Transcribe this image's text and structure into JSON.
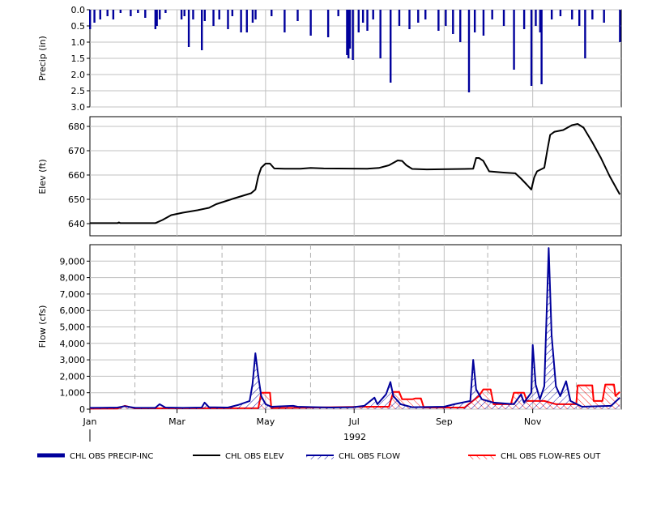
{
  "colors": {
    "precip": "#00009c",
    "elev": "#000000",
    "flow": "#00009c",
    "res_out": "#ff0000",
    "grid": "#c0c0c0",
    "grid_dashed": "#b0b0b0",
    "frame": "#000000"
  },
  "x_axis": {
    "year_label": "1992",
    "month_ticks": [
      "Jan",
      "Mar",
      "May",
      "Jul",
      "Sep",
      "Nov"
    ]
  },
  "legend": [
    {
      "label": "CHL OBS PRECIP-INC",
      "style": "thick-line",
      "color": "#00009c"
    },
    {
      "label": "CHL OBS ELEV",
      "style": "line",
      "color": "#000000"
    },
    {
      "label": "CHL OBS FLOW",
      "style": "hatched-line",
      "color": "#00009c"
    },
    {
      "label": "CHL OBS FLOW-RES OUT",
      "style": "hatched-line",
      "color": "#ff0000"
    }
  ],
  "chart_data": [
    {
      "type": "bar",
      "ylabel": "Precip (in)",
      "ylim": [
        3.0,
        0.0
      ],
      "inverted": true,
      "yticks": [
        "0.0",
        "0.5",
        "1.0",
        "1.5",
        "2.0",
        "2.5",
        "3.0"
      ],
      "grid": true,
      "series": [
        {
          "name": "CHL OBS PRECIP-INC",
          "points": [
            [
              "1992-01-01",
              0.6
            ],
            [
              "1992-01-04",
              0.4
            ],
            [
              "1992-01-08",
              0.3
            ],
            [
              "1992-01-13",
              0.2
            ],
            [
              "1992-01-17",
              0.3
            ],
            [
              "1992-01-22",
              0.1
            ],
            [
              "1992-01-29",
              0.2
            ],
            [
              "1992-02-03",
              0.1
            ],
            [
              "1992-02-08",
              0.25
            ],
            [
              "1992-02-15",
              0.6
            ],
            [
              "1992-02-16",
              0.5
            ],
            [
              "1992-02-18",
              0.3
            ],
            [
              "1992-02-22",
              0.1
            ],
            [
              "1992-03-04",
              0.3
            ],
            [
              "1992-03-06",
              0.2
            ],
            [
              "1992-03-09",
              1.15
            ],
            [
              "1992-03-12",
              0.3
            ],
            [
              "1992-03-18",
              1.25
            ],
            [
              "1992-03-20",
              0.35
            ],
            [
              "1992-03-26",
              0.5
            ],
            [
              "1992-03-30",
              0.3
            ],
            [
              "1992-04-05",
              0.6
            ],
            [
              "1992-04-08",
              0.2
            ],
            [
              "1992-04-14",
              0.7
            ],
            [
              "1992-04-18",
              0.7
            ],
            [
              "1992-04-22",
              0.4
            ],
            [
              "1992-04-24",
              0.3
            ],
            [
              "1992-05-05",
              0.2
            ],
            [
              "1992-05-14",
              0.7
            ],
            [
              "1992-05-23",
              0.35
            ],
            [
              "1992-06-01",
              0.8
            ],
            [
              "1992-06-13",
              0.85
            ],
            [
              "1992-06-20",
              0.2
            ],
            [
              "1992-06-26",
              1.4
            ],
            [
              "1992-06-27",
              1.5
            ],
            [
              "1992-06-28",
              1.2
            ],
            [
              "1992-06-30",
              1.55
            ],
            [
              "1992-07-04",
              0.7
            ],
            [
              "1992-07-07",
              0.4
            ],
            [
              "1992-07-10",
              0.65
            ],
            [
              "1992-07-14",
              0.3
            ],
            [
              "1992-07-19",
              1.5
            ],
            [
              "1992-07-26",
              2.25
            ],
            [
              "1992-08-01",
              0.5
            ],
            [
              "1992-08-08",
              0.6
            ],
            [
              "1992-08-14",
              0.4
            ],
            [
              "1992-08-19",
              0.3
            ],
            [
              "1992-08-28",
              0.65
            ],
            [
              "1992-09-02",
              0.5
            ],
            [
              "1992-09-07",
              0.75
            ],
            [
              "1992-09-12",
              1.0
            ],
            [
              "1992-09-18",
              2.55
            ],
            [
              "1992-09-22",
              0.7
            ],
            [
              "1992-09-28",
              0.8
            ],
            [
              "1992-10-04",
              0.3
            ],
            [
              "1992-10-12",
              0.5
            ],
            [
              "1992-10-19",
              1.85
            ],
            [
              "1992-10-26",
              0.6
            ],
            [
              "1992-10-31",
              2.35
            ],
            [
              "1992-11-03",
              0.5
            ],
            [
              "1992-11-06",
              0.7
            ],
            [
              "1992-11-07",
              2.3
            ],
            [
              "1992-11-14",
              0.3
            ],
            [
              "1992-11-20",
              0.2
            ],
            [
              "1992-11-28",
              0.3
            ],
            [
              "1992-12-03",
              0.5
            ],
            [
              "1992-12-07",
              1.5
            ],
            [
              "1992-12-12",
              0.3
            ],
            [
              "1992-12-20",
              0.4
            ],
            [
              "1992-12-31",
              1.0
            ]
          ]
        }
      ]
    },
    {
      "type": "line",
      "ylabel": "Elev (ft)",
      "ylim": [
        635,
        684
      ],
      "yticks": [
        "640",
        "650",
        "660",
        "670",
        "680"
      ],
      "grid": true,
      "series": [
        {
          "name": "CHL OBS ELEV",
          "points": [
            [
              "1992-01-01",
              640.2
            ],
            [
              "1992-01-20",
              640.2
            ],
            [
              "1992-01-21",
              640.5
            ],
            [
              "1992-01-22",
              640.2
            ],
            [
              "1992-02-15",
              640.2
            ],
            [
              "1992-02-20",
              641.5
            ],
            [
              "1992-02-26",
              643.5
            ],
            [
              "1992-03-05",
              644.5
            ],
            [
              "1992-03-15",
              645.5
            ],
            [
              "1992-03-23",
              646.5
            ],
            [
              "1992-03-28",
              648.0
            ],
            [
              "1992-04-10",
              650.5
            ],
            [
              "1992-04-21",
              652.5
            ],
            [
              "1992-04-24",
              654.0
            ],
            [
              "1992-04-26",
              659.5
            ],
            [
              "1992-04-28",
              663.0
            ],
            [
              "1992-05-01",
              664.7
            ],
            [
              "1992-05-04",
              664.7
            ],
            [
              "1992-05-07",
              662.7
            ],
            [
              "1992-05-14",
              662.6
            ],
            [
              "1992-05-25",
              662.6
            ],
            [
              "1992-06-01",
              662.9
            ],
            [
              "1992-06-10",
              662.7
            ],
            [
              "1992-07-10",
              662.6
            ],
            [
              "1992-07-18",
              662.9
            ],
            [
              "1992-07-25",
              664.0
            ],
            [
              "1992-07-31",
              666.0
            ],
            [
              "1992-08-03",
              665.8
            ],
            [
              "1992-08-06",
              664.0
            ],
            [
              "1992-08-10",
              662.5
            ],
            [
              "1992-08-20",
              662.3
            ],
            [
              "1992-09-15",
              662.5
            ],
            [
              "1992-09-21",
              662.6
            ],
            [
              "1992-09-23",
              667.0
            ],
            [
              "1992-09-25",
              667.0
            ],
            [
              "1992-09-28",
              665.8
            ],
            [
              "1992-10-02",
              661.5
            ],
            [
              "1992-10-12",
              661.0
            ],
            [
              "1992-10-20",
              660.7
            ],
            [
              "1992-10-24",
              658.5
            ],
            [
              "1992-10-28",
              656.0
            ],
            [
              "1992-10-31",
              654.0
            ],
            [
              "1992-11-02",
              659.0
            ],
            [
              "1992-11-04",
              661.5
            ],
            [
              "1992-11-09",
              663.0
            ],
            [
              "1992-11-11",
              670.0
            ],
            [
              "1992-11-13",
              676.5
            ],
            [
              "1992-11-16",
              677.8
            ],
            [
              "1992-11-22",
              678.5
            ],
            [
              "1992-11-28",
              680.5
            ],
            [
              "1992-12-02",
              681.0
            ],
            [
              "1992-12-06",
              679.5
            ],
            [
              "1992-12-12",
              673.5
            ],
            [
              "1992-12-18",
              667.0
            ],
            [
              "1992-12-24",
              659.5
            ],
            [
              "1992-12-31",
              652.0
            ]
          ]
        }
      ]
    },
    {
      "type": "area",
      "ylabel": "Flow (cfs)",
      "ylim": [
        0,
        10000
      ],
      "yticks": [
        "0",
        "1,000",
        "2,000",
        "3,000",
        "4,000",
        "5,000",
        "6,000",
        "7,000",
        "8,000",
        "9,000"
      ],
      "grid": true,
      "series": [
        {
          "name": "CHL OBS FLOW",
          "points": [
            [
              "1992-01-01",
              80
            ],
            [
              "1992-01-20",
              100
            ],
            [
              "1992-01-25",
              180
            ],
            [
              "1992-02-01",
              80
            ],
            [
              "1992-02-15",
              80
            ],
            [
              "1992-02-18",
              300
            ],
            [
              "1992-02-22",
              100
            ],
            [
              "1992-03-05",
              80
            ],
            [
              "1992-03-18",
              100
            ],
            [
              "1992-03-20",
              400
            ],
            [
              "1992-03-23",
              120
            ],
            [
              "1992-04-05",
              100
            ],
            [
              "1992-04-12",
              250
            ],
            [
              "1992-04-20",
              500
            ],
            [
              "1992-04-22",
              1500
            ],
            [
              "1992-04-24",
              3400
            ],
            [
              "1992-04-26",
              2000
            ],
            [
              "1992-04-28",
              800
            ],
            [
              "1992-05-01",
              300
            ],
            [
              "1992-05-05",
              150
            ],
            [
              "1992-05-20",
              200
            ],
            [
              "1992-05-23",
              150
            ],
            [
              "1992-06-15",
              100
            ],
            [
              "1992-06-30",
              120
            ],
            [
              "1992-07-08",
              200
            ],
            [
              "1992-07-15",
              700
            ],
            [
              "1992-07-17",
              300
            ],
            [
              "1992-07-23",
              900
            ],
            [
              "1992-07-26",
              1650
            ],
            [
              "1992-07-28",
              800
            ],
            [
              "1992-08-02",
              300
            ],
            [
              "1992-08-10",
              120
            ],
            [
              "1992-09-01",
              150
            ],
            [
              "1992-09-08",
              300
            ],
            [
              "1992-09-19",
              500
            ],
            [
              "1992-09-21",
              3000
            ],
            [
              "1992-09-23",
              1200
            ],
            [
              "1992-09-27",
              600
            ],
            [
              "1992-10-05",
              400
            ],
            [
              "1992-10-19",
              300
            ],
            [
              "1992-10-24",
              900
            ],
            [
              "1992-10-26",
              400
            ],
            [
              "1992-10-31",
              1000
            ],
            [
              "1992-11-01",
              3900
            ],
            [
              "1992-11-03",
              1500
            ],
            [
              "1992-11-06",
              600
            ],
            [
              "1992-11-09",
              1400
            ],
            [
              "1992-11-12",
              9800
            ],
            [
              "1992-11-14",
              4500
            ],
            [
              "1992-11-17",
              1400
            ],
            [
              "1992-11-20",
              800
            ],
            [
              "1992-11-24",
              1700
            ],
            [
              "1992-11-27",
              500
            ],
            [
              "1992-12-05",
              150
            ],
            [
              "1992-12-25",
              200
            ],
            [
              "1992-12-31",
              700
            ]
          ]
        },
        {
          "name": "CHL OBS FLOW-RES OUT",
          "points": [
            [
              "1992-01-01",
              30
            ],
            [
              "1992-01-20",
              40
            ],
            [
              "1992-01-25",
              200
            ],
            [
              "1992-02-01",
              50
            ],
            [
              "1992-04-26",
              60
            ],
            [
              "1992-04-28",
              1000
            ],
            [
              "1992-05-04",
              1000
            ],
            [
              "1992-05-05",
              60
            ],
            [
              "1992-07-08",
              150
            ],
            [
              "1992-07-25",
              150
            ],
            [
              "1992-07-28",
              1050
            ],
            [
              "1992-08-01",
              1050
            ],
            [
              "1992-08-03",
              600
            ],
            [
              "1992-08-10",
              600
            ],
            [
              "1992-08-12",
              650
            ],
            [
              "1992-08-16",
              650
            ],
            [
              "1992-08-18",
              100
            ],
            [
              "1992-09-15",
              100
            ],
            [
              "1992-09-25",
              800
            ],
            [
              "1992-09-28",
              1200
            ],
            [
              "1992-10-03",
              1200
            ],
            [
              "1992-10-05",
              300
            ],
            [
              "1992-10-17",
              300
            ],
            [
              "1992-10-19",
              1000
            ],
            [
              "1992-10-26",
              1000
            ],
            [
              "1992-10-28",
              500
            ],
            [
              "1992-11-09",
              500
            ],
            [
              "1992-11-17",
              300
            ],
            [
              "1992-12-01",
              300
            ],
            [
              "1992-12-02",
              1450
            ],
            [
              "1992-12-12",
              1450
            ],
            [
              "1992-12-13",
              500
            ],
            [
              "1992-12-19",
              500
            ],
            [
              "1992-12-21",
              1500
            ],
            [
              "1992-12-27",
              1500
            ],
            [
              "1992-12-28",
              800
            ],
            [
              "1992-12-31",
              1050
            ]
          ]
        }
      ]
    }
  ]
}
